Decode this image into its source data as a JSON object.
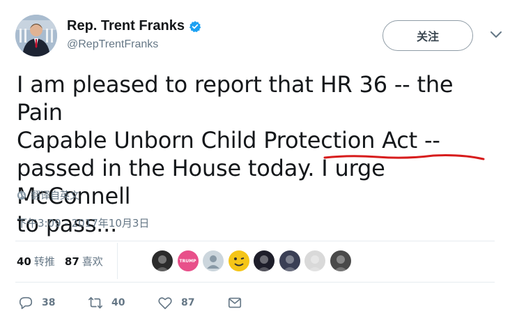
{
  "author": {
    "display_name": "Rep. Trent Franks",
    "handle": "@RepTrentFranks"
  },
  "follow_button": "关注",
  "tweet": {
    "lines": [
      "I am pleased to report that HR 36 -- the Pain",
      "Capable Unborn Child Protection Act --",
      "passed in the House today. I urge McConnell",
      "to pass..."
    ]
  },
  "translate_label": "翻译自英文",
  "timestamp": "下午3:09 - 2017年10月3日",
  "stats": {
    "retweets_count": "40",
    "retweets_label": "转推",
    "likes_count": "87",
    "likes_label": "喜欢"
  },
  "actions": {
    "reply_count": "38",
    "retweet_count": "40",
    "like_count": "87"
  },
  "liker_avatars": [
    {
      "name": "liker-avatar-1",
      "color": "#2b2b2b"
    },
    {
      "name": "liker-avatar-2",
      "color": "#e8508a",
      "text": "TRUMP"
    },
    {
      "name": "liker-avatar-3",
      "color": "#ccd6dd"
    },
    {
      "name": "liker-avatar-4",
      "color": "#f5c518"
    },
    {
      "name": "liker-avatar-5",
      "color": "#1e1e2a"
    },
    {
      "name": "liker-avatar-6",
      "color": "#3a3f55"
    },
    {
      "name": "liker-avatar-7",
      "color": "#d9d9d9"
    },
    {
      "name": "liker-avatar-8",
      "color": "#4a4a4a"
    }
  ],
  "colors": {
    "verified": "#1da1f2",
    "underline": "#d71c1c",
    "muted": "#657786"
  }
}
